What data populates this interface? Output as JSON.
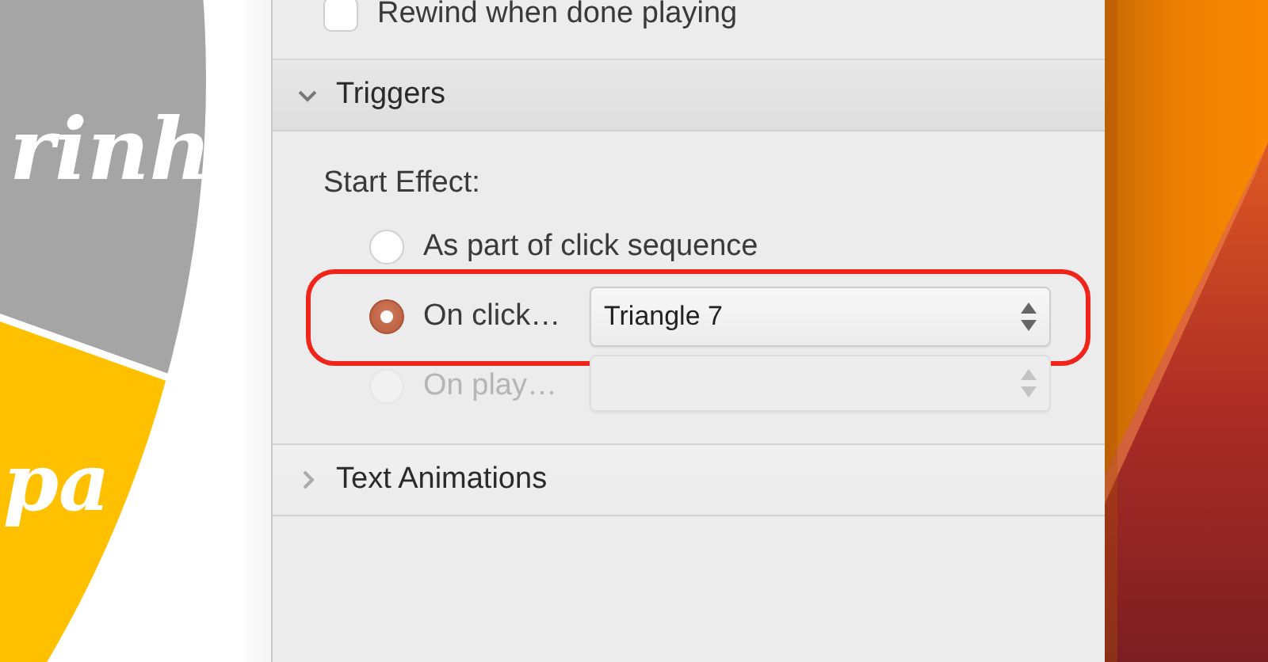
{
  "slide": {
    "slices": [
      {
        "label": "rinh",
        "color": "#a5a5a5"
      },
      {
        "label": "pa",
        "color": "#ffc000"
      }
    ]
  },
  "inspector": {
    "top_options": [
      {
        "kind": "checkbox",
        "label": "Rewind when done playing",
        "checked": false
      }
    ],
    "sections": [
      {
        "title": "Triggers",
        "expanded": true,
        "field_label": "Start Effect:",
        "options": [
          {
            "kind": "radio",
            "label": "As part of click sequence",
            "selected": false,
            "disabled": false,
            "highlighted": false
          },
          {
            "kind": "radio_popup",
            "label": "On click…",
            "selected": true,
            "disabled": false,
            "highlighted": true,
            "popup_value": "Triangle 7"
          },
          {
            "kind": "radio_popup",
            "label": "On play…",
            "selected": false,
            "disabled": true,
            "highlighted": false
          }
        ]
      },
      {
        "title": "Text Animations",
        "expanded": false
      }
    ]
  }
}
